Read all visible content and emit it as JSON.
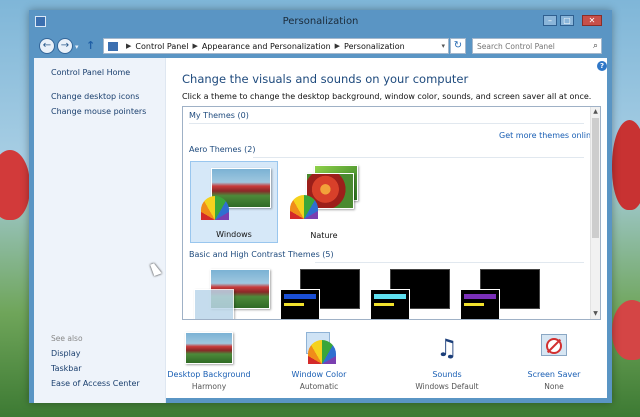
{
  "window": {
    "title": "Personalization"
  },
  "address": {
    "crumbs": [
      "Control Panel",
      "Appearance and Personalization",
      "Personalization"
    ],
    "search_placeholder": "Search Control Panel"
  },
  "sidebar": {
    "items": [
      "Control Panel Home",
      "Change desktop icons",
      "Change mouse pointers"
    ],
    "see_also_label": "See also",
    "see_also": [
      "Display",
      "Taskbar",
      "Ease of Access Center"
    ]
  },
  "main": {
    "title": "Change the visuals and sounds on your computer",
    "description": "Click a theme to change the desktop background, window color, sounds, and screen saver all at once.",
    "groups": {
      "my_themes": "My Themes (0)",
      "get_more": "Get more themes online",
      "aero": "Aero Themes (2)",
      "basic": "Basic and High Contrast Themes (5)"
    },
    "aero_themes": [
      {
        "name": "Windows",
        "selected": true
      },
      {
        "name": "Nature",
        "selected": false
      }
    ]
  },
  "bottom": [
    {
      "label": "Desktop Background",
      "value": "Harmony",
      "icon": "desktop-background-icon"
    },
    {
      "label": "Window Color",
      "value": "Automatic",
      "icon": "window-color-icon"
    },
    {
      "label": "Sounds",
      "value": "Windows Default",
      "icon": "sounds-icon"
    },
    {
      "label": "Screen Saver",
      "value": "None",
      "icon": "screen-saver-icon"
    }
  ],
  "colors": {
    "frame": "#5a95c4",
    "link": "#1a5fb4",
    "heading": "#1e4a7d",
    "selection": "#d6e8f8"
  }
}
